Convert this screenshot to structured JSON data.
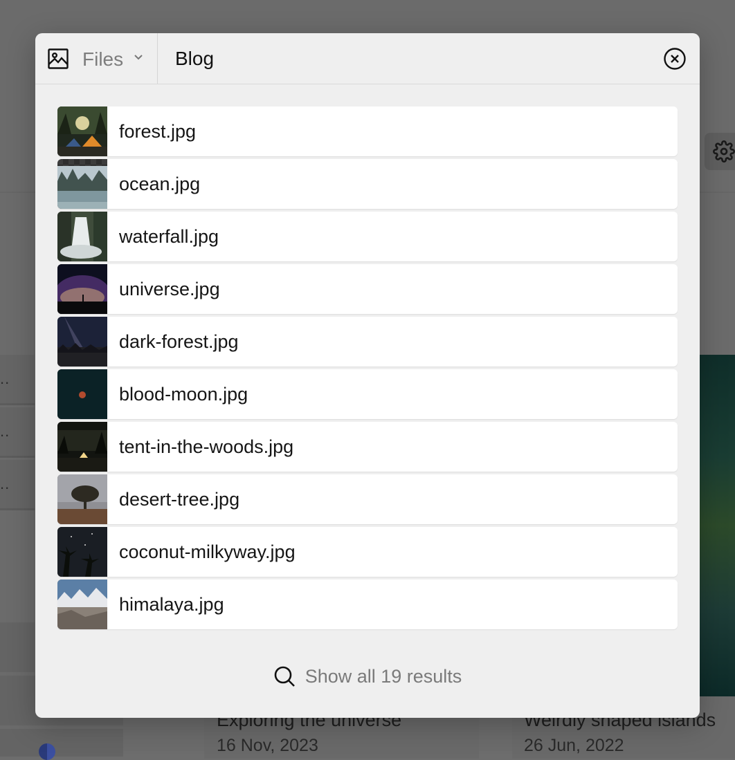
{
  "search": {
    "scope_label": "Files",
    "query": "Blog",
    "scope_icon": "image-icon",
    "close_icon": "close-circle-icon"
  },
  "results": [
    {
      "filename": "forest.jpg"
    },
    {
      "filename": "ocean.jpg"
    },
    {
      "filename": "waterfall.jpg"
    },
    {
      "filename": "universe.jpg"
    },
    {
      "filename": "dark-forest.jpg"
    },
    {
      "filename": "blood-moon.jpg"
    },
    {
      "filename": "tent-in-the-woods.jpg"
    },
    {
      "filename": "desert-tree.jpg"
    },
    {
      "filename": "coconut-milkyway.jpg"
    },
    {
      "filename": "himalaya.jpg"
    }
  ],
  "footer": {
    "show_all_label": "Show all 19 results",
    "icon": "search-icon"
  },
  "background": {
    "list_item_text": "..",
    "cards": [
      {
        "title": "Exploring the universe",
        "date": "16 Nov, 2023"
      },
      {
        "title": "Weirdly shaped islands",
        "date": "26 Jun, 2022"
      }
    ]
  },
  "colors": {
    "overlay": "#6b6b6b",
    "modal_bg": "#efefef",
    "row_bg": "#ffffff",
    "muted_text": "#7a7a7a"
  }
}
